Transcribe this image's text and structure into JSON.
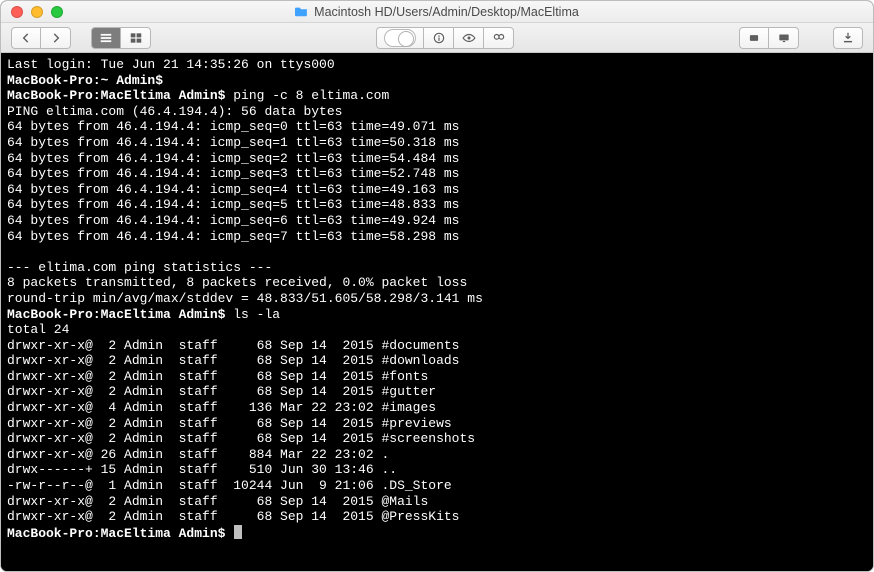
{
  "window": {
    "title": "Macintosh HD/Users/Admin/Desktop/MacEltima"
  },
  "session": {
    "last_login": "Last login: Tue Jun 21 14:35:26 on ttys000",
    "prompt_home": "MacBook-Pro:~ Admin$",
    "prompt_dir": "MacBook-Pro:MacEltima Admin$",
    "cmd_ping": "ping -c 8 eltima.com",
    "ping_header": "PING eltima.com (46.4.194.4): 56 data bytes",
    "ping_lines": [
      "64 bytes from 46.4.194.4: icmp_seq=0 ttl=63 time=49.071 ms",
      "64 bytes from 46.4.194.4: icmp_seq=1 ttl=63 time=50.318 ms",
      "64 bytes from 46.4.194.4: icmp_seq=2 ttl=63 time=54.484 ms",
      "64 bytes from 46.4.194.4: icmp_seq=3 ttl=63 time=52.748 ms",
      "64 bytes from 46.4.194.4: icmp_seq=4 ttl=63 time=49.163 ms",
      "64 bytes from 46.4.194.4: icmp_seq=5 ttl=63 time=48.833 ms",
      "64 bytes from 46.4.194.4: icmp_seq=6 ttl=63 time=49.924 ms",
      "64 bytes from 46.4.194.4: icmp_seq=7 ttl=63 time=58.298 ms"
    ],
    "stats_header": "--- eltima.com ping statistics ---",
    "stats_line1": "8 packets transmitted, 8 packets received, 0.0% packet loss",
    "stats_line2": "round-trip min/avg/max/stddev = 48.833/51.605/58.298/3.141 ms",
    "cmd_ls": "ls -la",
    "ls_total": "total 24",
    "ls_rows": [
      "drwxr-xr-x@  2 Admin  staff     68 Sep 14  2015 #documents",
      "drwxr-xr-x@  2 Admin  staff     68 Sep 14  2015 #downloads",
      "drwxr-xr-x@  2 Admin  staff     68 Sep 14  2015 #fonts",
      "drwxr-xr-x@  2 Admin  staff     68 Sep 14  2015 #gutter",
      "drwxr-xr-x@  4 Admin  staff    136 Mar 22 23:02 #images",
      "drwxr-xr-x@  2 Admin  staff     68 Sep 14  2015 #previews",
      "drwxr-xr-x@  2 Admin  staff     68 Sep 14  2015 #screenshots",
      "drwxr-xr-x@ 26 Admin  staff    884 Mar 22 23:02 .",
      "drwx------+ 15 Admin  staff    510 Jun 30 13:46 ..",
      "-rw-r--r--@  1 Admin  staff  10244 Jun  9 21:06 .DS_Store",
      "drwxr-xr-x@  2 Admin  staff     68 Sep 14  2015 @Mails",
      "drwxr-xr-x@  2 Admin  staff     68 Sep 14  2015 @PressKits"
    ]
  },
  "icons": {
    "folder": "folder-icon",
    "back": "chevron-left-icon",
    "forward": "chevron-right-icon",
    "view_icon": "grid-icon",
    "view_list": "list-icon",
    "toggle": "toggle-icon",
    "info": "info-icon",
    "eye": "eye-icon",
    "binoculars": "binoculars-icon",
    "drive": "drive-icon",
    "window": "window-icon",
    "download": "download-icon"
  }
}
